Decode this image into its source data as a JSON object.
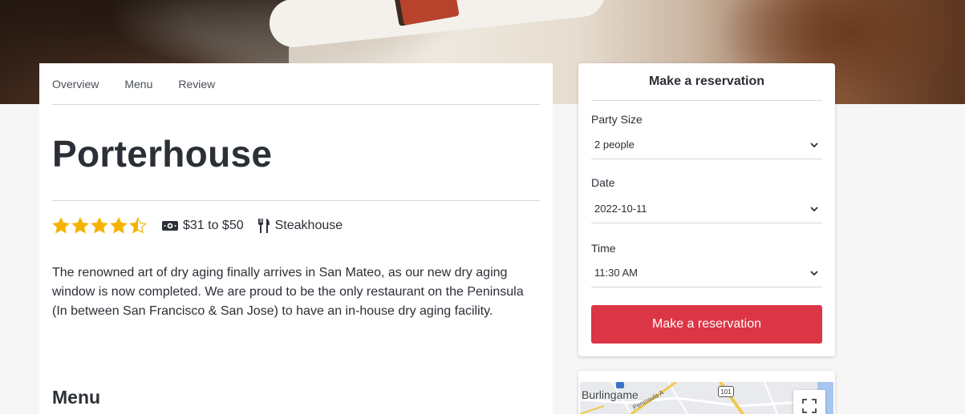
{
  "tabs": [
    {
      "label": "Overview"
    },
    {
      "label": "Menu"
    },
    {
      "label": "Review"
    }
  ],
  "restaurant": {
    "name": "Porterhouse",
    "rating": 4.5,
    "rating_max": 5,
    "price_range": "$31 to $50",
    "cuisine": "Steakhouse",
    "description": "The renowned art of dry aging finally arrives in San Mateo, as our new dry aging window is now completed. We are proud to be the only restaurant on the Peninsula (In between San Francisco & San Jose) to have an in-house dry aging facility."
  },
  "menu_section": {
    "heading": "Menu"
  },
  "reservation": {
    "title": "Make a reservation",
    "party_size_label": "Party Size",
    "party_size_value": "2 people",
    "date_label": "Date",
    "date_value": "2022-10-11",
    "time_label": "Time",
    "time_value": "11:30 AM",
    "button_label": "Make a reservation"
  },
  "map": {
    "city_label": "Burlingame",
    "road_label": "Peninsula A",
    "highway": "101"
  },
  "colors": {
    "accent": "#dc3545",
    "star": "#f5b301",
    "text": "#2b2f36"
  },
  "icons": {
    "money": "money-icon",
    "cuisine": "utensils-icon",
    "chevron": "chevron-down-icon",
    "fullscreen": "fullscreen-icon"
  }
}
